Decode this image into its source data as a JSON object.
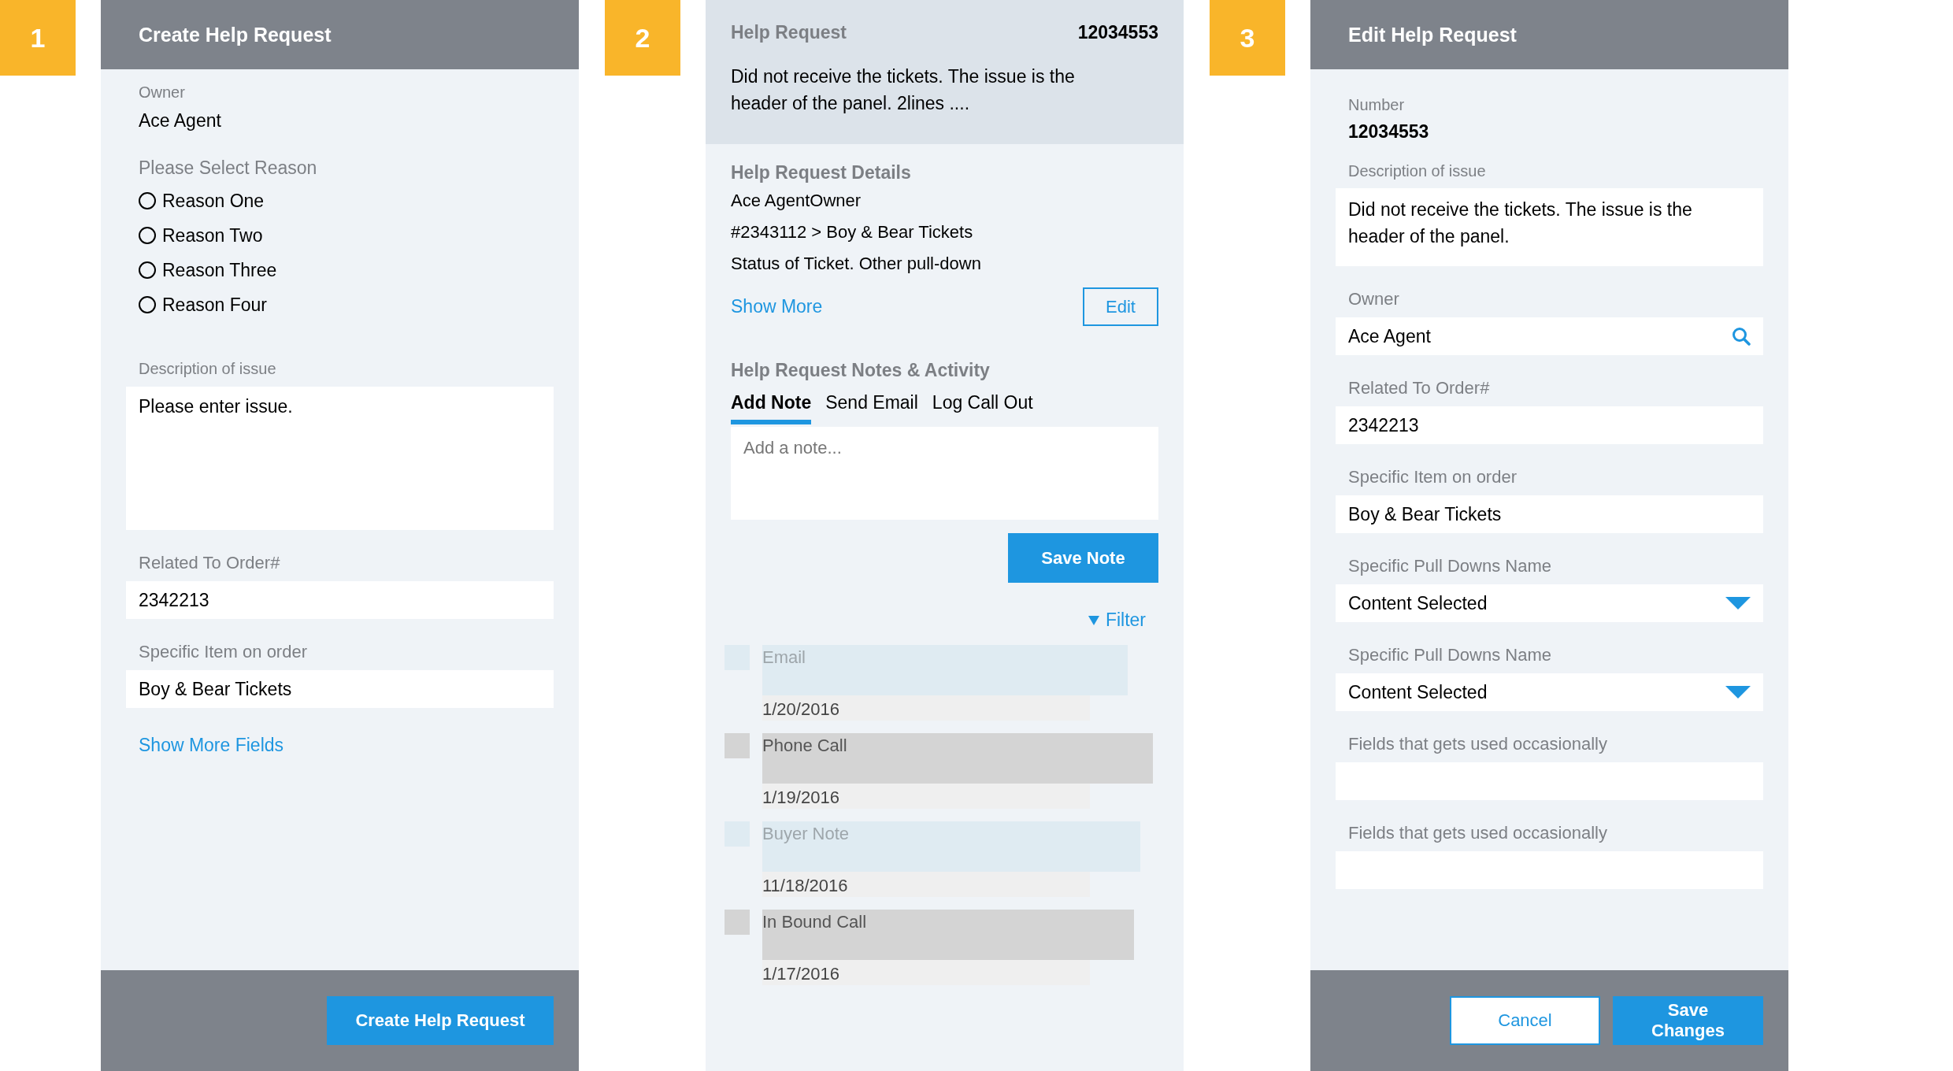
{
  "create_panel": {
    "step": "1",
    "title": "Create Help Request",
    "owner": {
      "label": "Owner",
      "value": "Ace Agent"
    },
    "reason": {
      "label": "Please Select Reason",
      "options": [
        {
          "label": "Reason One",
          "selected": false
        },
        {
          "label": "Reason Two",
          "selected": false
        },
        {
          "label": "Reason Three",
          "selected": false
        },
        {
          "label": "Reason Four",
          "selected": false
        }
      ]
    },
    "description": {
      "label": "Description of issue",
      "value": "Please enter issue."
    },
    "related_order": {
      "label": "Related To Order#",
      "value": "2342213"
    },
    "specific_item": {
      "label": "Specific Item on order",
      "value": "Boy & Bear Tickets"
    },
    "show_more_link": "Show More Fields",
    "submit_button": "Create Help Request"
  },
  "detail_panel": {
    "step": "2",
    "header": {
      "title": "Help Request",
      "number": "12034553",
      "description": "Did not receive the tickets. The issue is the header of the panel. 2lines ...."
    },
    "details": {
      "title": "Help Request Details",
      "lines": [
        "Ace AgentOwner",
        "#2343112 > Boy & Bear Tickets",
        "Status of Ticket. Other pull-down"
      ],
      "show_more_link": "Show More",
      "edit_button": "Edit"
    },
    "notes": {
      "title": "Help Request Notes & Activity",
      "tabs": [
        {
          "label": "Add Note",
          "selected": true
        },
        {
          "label": "Send Email",
          "selected": false
        },
        {
          "label": "Log Call Out",
          "selected": false
        }
      ],
      "note_field": {
        "placeholder": "Add a note..."
      },
      "save_button": "Save Note",
      "filter_link": "Filter",
      "activities": [
        {
          "title": "Email",
          "date": "1/20/2016",
          "color": "#dfebf2"
        },
        {
          "title": "Phone Call",
          "date": "1/19/2016",
          "color": "#d4d4d4"
        },
        {
          "title": "Buyer Note",
          "date": "11/18/2016",
          "color": "#dfebf2"
        },
        {
          "title": "In Bound Call",
          "date": "1/17/2016",
          "color": "#d4d4d4"
        }
      ]
    }
  },
  "edit_panel": {
    "step": "3",
    "title": "Edit Help Request",
    "number": {
      "label": "Number",
      "value": "12034553"
    },
    "fields": [
      {
        "kind": "textarea",
        "label": "Description of issue",
        "value": "Did not receive the tickets. The issue is the header of the panel."
      },
      {
        "kind": "search",
        "label": "Owner",
        "value": "Ace Agent"
      },
      {
        "kind": "text",
        "label": "Related To Order#",
        "value": "2342213"
      },
      {
        "kind": "text",
        "label": "Specific Item on order",
        "value": "Boy & Bear Tickets"
      },
      {
        "kind": "select",
        "label": "Specific Pull Downs Name",
        "value": "Content Selected"
      },
      {
        "kind": "select",
        "label": "Specific Pull Downs Name",
        "value": "Content Selected"
      },
      {
        "kind": "text",
        "label": "Fields that gets used occasionally"
      },
      {
        "kind": "text",
        "label": "Fields that gets used occasionally"
      }
    ],
    "cancel_button": "Cancel",
    "save_button": "Save Changes"
  }
}
